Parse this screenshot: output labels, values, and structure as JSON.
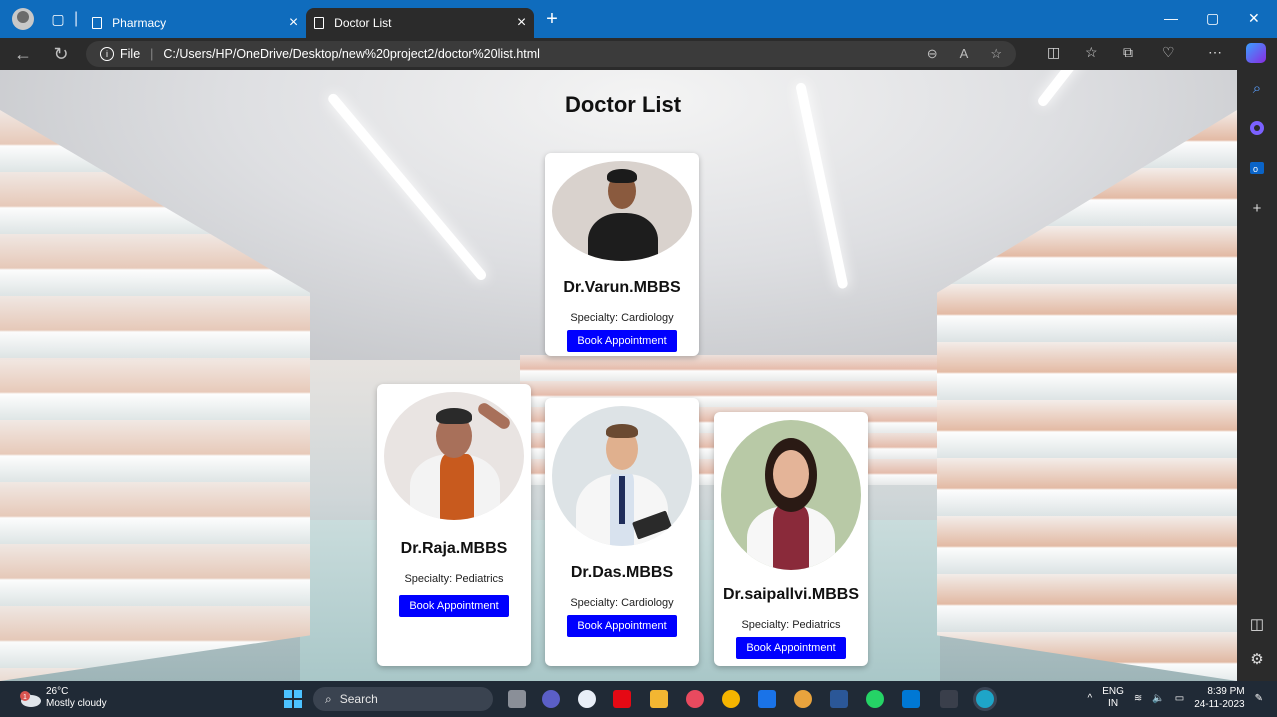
{
  "browser": {
    "tabs": [
      {
        "label": "Pharmacy",
        "active": false
      },
      {
        "label": "Doctor List",
        "active": true
      }
    ],
    "address": {
      "scheme_label": "File",
      "url": "C:/Users/HP/OneDrive/Desktop/new%20project2/doctor%20list.html"
    }
  },
  "page": {
    "title": "Doctor List",
    "doctors": [
      {
        "name": "Dr.Varun.MBBS",
        "specialty": "Specialty: Cardiology",
        "button": "Book Appointment"
      },
      {
        "name": "Dr.Raja.MBBS",
        "specialty": "Specialty: Pediatrics",
        "button": "Book Appointment"
      },
      {
        "name": "Dr.Das.MBBS",
        "specialty": "Specialty: Cardiology",
        "button": "Book Appointment"
      },
      {
        "name": "Dr.saipallvi.MBBS",
        "specialty": "Specialty: Pediatrics",
        "button": "Book Appointment"
      }
    ]
  },
  "taskbar": {
    "weather": {
      "temp": "26°C",
      "condition": "Mostly cloudy",
      "badge": "1"
    },
    "search_placeholder": "Search",
    "language": {
      "code": "ENG",
      "region": "IN"
    },
    "clock": {
      "time": "8:39 PM",
      "date": "24-11-2023"
    }
  },
  "colors": {
    "titlebar": "#0f6cbd",
    "toolbar": "#2b2b2b",
    "button": "#0000ff",
    "taskbar": "#202a36"
  }
}
